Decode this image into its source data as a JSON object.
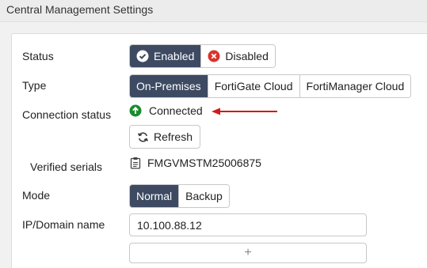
{
  "header": {
    "title": "Central Management Settings"
  },
  "form": {
    "status": {
      "label": "Status",
      "options": [
        {
          "label": "Enabled",
          "icon": "check-circle-icon",
          "active": true
        },
        {
          "label": "Disabled",
          "icon": "x-circle-icon",
          "active": false
        }
      ]
    },
    "type": {
      "label": "Type",
      "options": [
        {
          "label": "On-Premises",
          "active": true
        },
        {
          "label": "FortiGate Cloud",
          "active": false
        },
        {
          "label": "FortiManager Cloud",
          "active": false
        }
      ]
    },
    "connection": {
      "label": "Connection status",
      "value": "Connected",
      "icon": "arrow-up-circle-icon",
      "refresh_label": "Refresh"
    },
    "serials": {
      "label": "Verified serials",
      "value": "FMGVMSTM25006875",
      "icon": "clipboard-icon"
    },
    "mode": {
      "label": "Mode",
      "options": [
        {
          "label": "Normal",
          "active": true
        },
        {
          "label": "Backup",
          "active": false
        }
      ]
    },
    "ip": {
      "label": "IP/Domain name",
      "value": "10.100.88.12",
      "add_label": "+"
    }
  },
  "colors": {
    "active_segment": "#3d4a62",
    "enabled_check": "#ffffff",
    "disabled_x": "#d9342b",
    "connected_green": "#1a8c2e",
    "annotation_arrow": "#d11a1a"
  }
}
